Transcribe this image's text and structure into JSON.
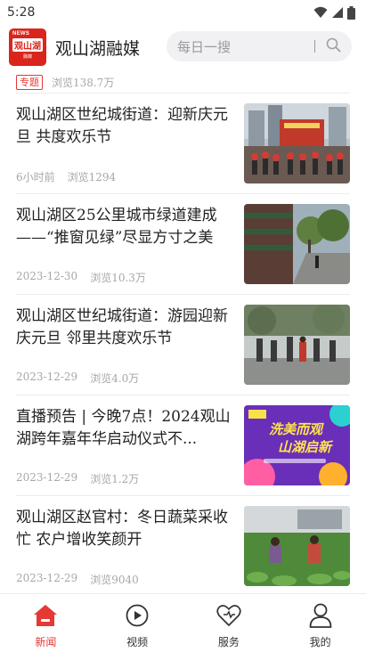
{
  "status_bar": {
    "time": "5:28",
    "icons": [
      "wifi-icon",
      "signal-icon",
      "battery-icon"
    ]
  },
  "header": {
    "logo": {
      "news": "NEWS",
      "main": "观山湖",
      "sub": "融媒"
    },
    "title": "观山湖融媒",
    "search": {
      "placeholder": "每日一搜",
      "icon": "search-icon"
    }
  },
  "feed": {
    "partial": {
      "tag": "专题",
      "views": "浏览138.7万"
    },
    "items": [
      {
        "title": "观山湖区世纪城街道：迎新庆元旦 共度欢乐节",
        "time": "6小时前",
        "views": "浏览1294"
      },
      {
        "title": "观山湖区25公里城市绿道建成——“推窗见绿”尽显方寸之美",
        "time": "2023-12-30",
        "views": "浏览10.3万"
      },
      {
        "title": "观山湖区世纪城街道：游园迎新庆元旦 邻里共度欢乐节",
        "time": "2023-12-29",
        "views": "浏览4.0万"
      },
      {
        "title": "直播预告 | 今晚7点！2024观山湖跨年嘉年华启动仪式不...",
        "time": "2023-12-29",
        "views": "浏览1.2万"
      },
      {
        "title": "观山湖区赵官村：冬日蔬菜采收忙 农户增收笑颜开",
        "time": "2023-12-29",
        "views": "浏览9040"
      }
    ],
    "thumb_poster_text": {
      "line1": "洗美而观",
      "line2": "山湖启新"
    }
  },
  "tabbar": {
    "tabs": [
      {
        "label": "新闻",
        "icon": "home-icon",
        "active": true
      },
      {
        "label": "视频",
        "icon": "play-icon",
        "active": false
      },
      {
        "label": "服务",
        "icon": "heart-icon",
        "active": false
      },
      {
        "label": "我的",
        "icon": "person-icon",
        "active": false
      }
    ]
  },
  "colors": {
    "accent": "#e53935",
    "logo": "#d9251c",
    "meta_text": "#a7a7a7"
  }
}
